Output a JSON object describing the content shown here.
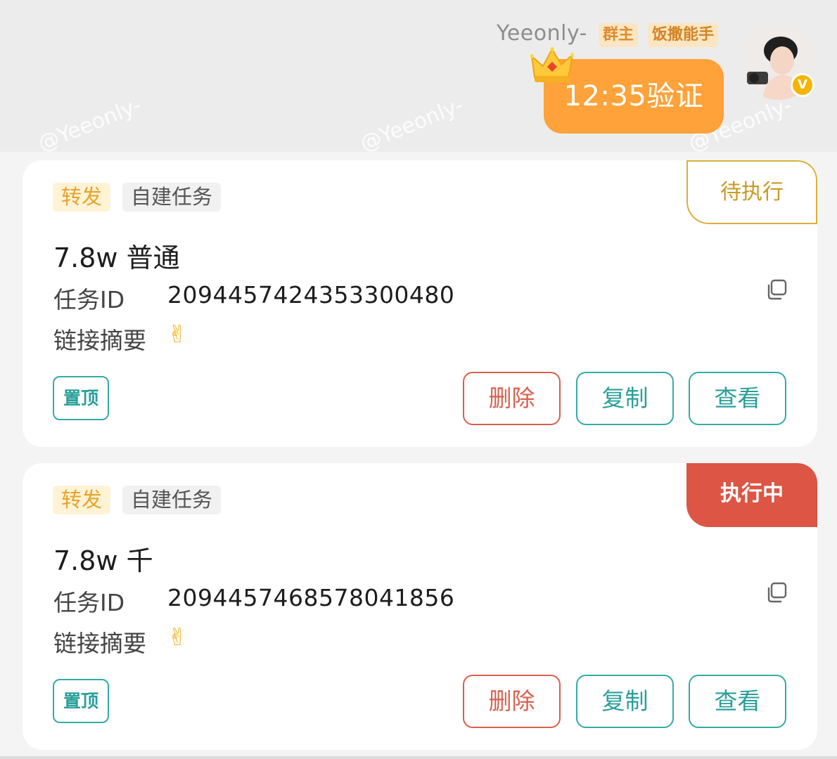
{
  "chat": {
    "sender_name": "Yeeonly-",
    "badges": [
      "群主",
      "饭撒能手"
    ],
    "message": "12:35验证",
    "watermark": "@Yeeonly-",
    "verified_mark": "V"
  },
  "tasks": [
    {
      "tags": [
        "转发",
        "自建任务"
      ],
      "status": "待执行",
      "title": "7.8w 普通",
      "id_label": "任务ID",
      "id_value": "2094457424353300480",
      "summary_label": "链接摘要",
      "summary_value": "✌",
      "pin_label": "置顶",
      "delete_label": "删除",
      "copy_label": "复制",
      "view_label": "查看"
    },
    {
      "tags": [
        "转发",
        "自建任务"
      ],
      "status": "执行中",
      "title": "7.8w 千",
      "id_label": "任务ID",
      "id_value": "2094457468578041856",
      "summary_label": "链接摘要",
      "summary_value": "✌",
      "pin_label": "置顶",
      "delete_label": "删除",
      "copy_label": "复制",
      "view_label": "查看"
    }
  ],
  "colors": {
    "bubble": "#ffa23a",
    "pending": "#c89a25",
    "running": "#dc5545",
    "teal": "#2a9f99",
    "delete": "#d9604f"
  },
  "icons": [
    "crown-icon",
    "verified-icon",
    "copy-icon",
    "victory-hand-icon"
  ]
}
